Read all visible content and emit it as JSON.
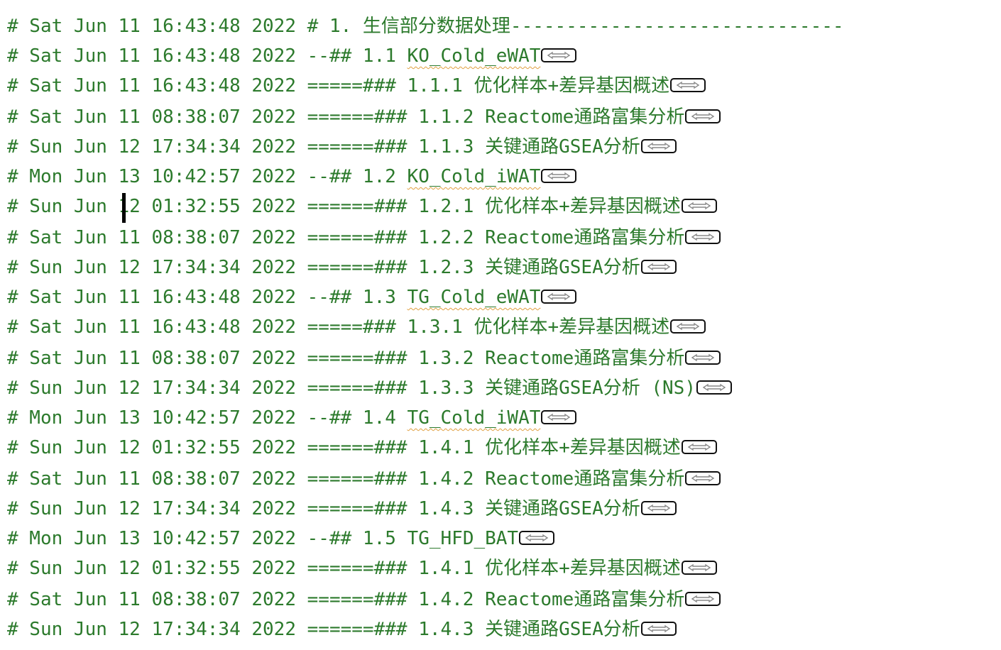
{
  "colors": {
    "comment": "#2c7a2c",
    "background": "#ffffff"
  },
  "header": {
    "date": "# Sat Jun 11 16:43:48 2022",
    "text": "# 1. 生信部分数据处理------------------------------"
  },
  "lines": [
    {
      "date": "# Sat Jun 11 16:43:48 2022",
      "prefix": "--## 1.1 ",
      "title": "KO_Cold_eWAT"
    },
    {
      "date": "# Sat Jun 11 16:43:48 2022",
      "prefix": "=====### 1.1.1 ",
      "title": "优化样本+差异基因概述"
    },
    {
      "date": "# Sat Jun 11 08:38:07 2022",
      "prefix": "======### 1.1.2 ",
      "title": "Reactome通路富集分析"
    },
    {
      "date": "# Sun Jun 12 17:34:34 2022",
      "prefix": "======### 1.1.3 ",
      "title": "关键通路GSEA分析"
    },
    {
      "date": "# Mon Jun 13 10:42:57 2022",
      "prefix": "--## 1.2 ",
      "title": "KO_Cold_iWAT"
    },
    {
      "date": "# Sun Jun 12 01:32:55 2022",
      "prefix": "======### 1.2.1 ",
      "title": "优化样本+差异基因概述"
    },
    {
      "date": "# Sat Jun 11 08:38:07 2022",
      "prefix": "======### 1.2.2 ",
      "title": "Reactome通路富集分析"
    },
    {
      "date": "# Sun Jun 12 17:34:34 2022",
      "prefix": "======### 1.2.3 ",
      "title": "关键通路GSEA分析"
    },
    {
      "date": "# Sat Jun 11 16:43:48 2022",
      "prefix": "--## 1.3 ",
      "title": "TG_Cold_eWAT"
    },
    {
      "date": "# Sat Jun 11 16:43:48 2022",
      "prefix": "=====### 1.3.1 ",
      "title": "优化样本+差异基因概述"
    },
    {
      "date": "# Sat Jun 11 08:38:07 2022",
      "prefix": "======### 1.3.2 ",
      "title": "Reactome通路富集分析"
    },
    {
      "date": "# Sun Jun 12 17:34:34 2022",
      "prefix": "======### 1.3.3 ",
      "title": "关键通路GSEA分析 (NS)"
    },
    {
      "date": "# Mon Jun 13 10:42:57 2022",
      "prefix": "--## 1.4 ",
      "title": "TG_Cold_iWAT"
    },
    {
      "date": "# Sun Jun 12 01:32:55 2022",
      "prefix": "======### 1.4.1 ",
      "title": "优化样本+差异基因概述"
    },
    {
      "date": "# Sat Jun 11 08:38:07 2022",
      "prefix": "======### 1.4.2 ",
      "title": "Reactome通路富集分析"
    },
    {
      "date": "# Sun Jun 12 17:34:34 2022",
      "prefix": "======### 1.4.3 ",
      "title": "关键通路GSEA分析"
    },
    {
      "date": "# Mon Jun 13 10:42:57 2022",
      "prefix": "--## 1.5 ",
      "title": "TG_HFD_BAT"
    },
    {
      "date": "# Sun Jun 12 01:32:55 2022",
      "prefix": "======### 1.4.1 ",
      "title": "优化样本+差异基因概述"
    },
    {
      "date": "# Sat Jun 11 08:38:07 2022",
      "prefix": "======### 1.4.2 ",
      "title": "Reactome通路富集分析"
    },
    {
      "date": "# Sun Jun 12 17:34:34 2022",
      "prefix": "======### 1.4.3 ",
      "title": "关键通路GSEA分析"
    }
  ]
}
